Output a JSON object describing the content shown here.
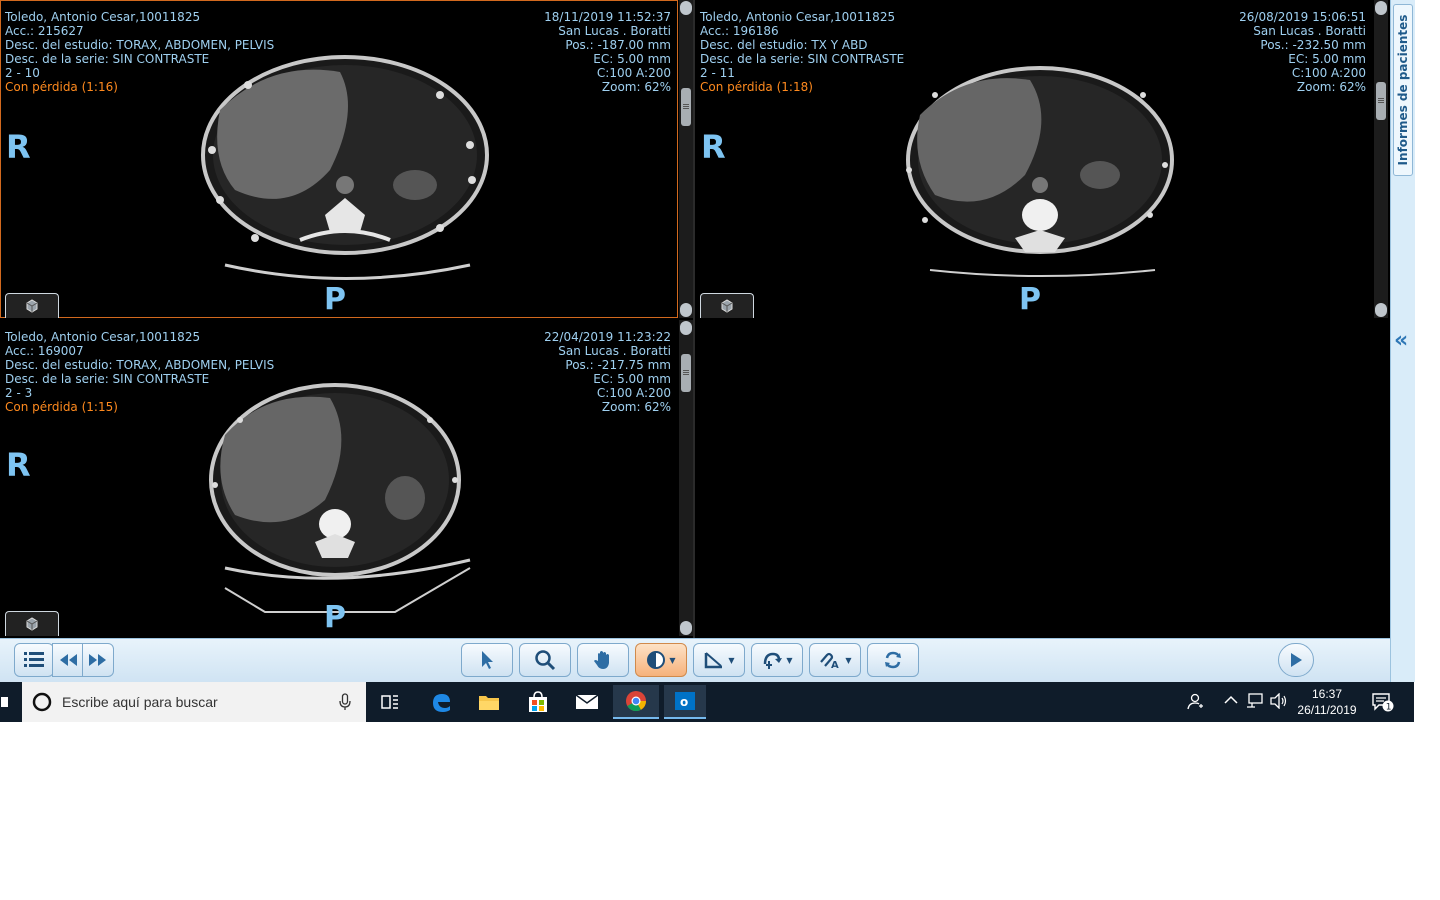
{
  "viewports": [
    {
      "left_lines": [
        "Toledo, Antonio Cesar,10011825",
        "Acc.: 215627",
        "Desc. del estudio: TORAX, ABDOMEN, PELVIS",
        "Desc. de la serie: SIN CONTRASTE",
        "2 - 10"
      ],
      "loss": "Con pérdida (1:16)",
      "right_lines": [
        "18/11/2019 11:52:37",
        "San Lucas . Boratti",
        "Pos.: -187.00 mm",
        "EC: 5.00 mm",
        "C:100 A:200",
        "Zoom: 62%"
      ],
      "orient_side": "R",
      "orient_bottom": "P"
    },
    {
      "left_lines": [
        "Toledo, Antonio Cesar,10011825",
        "Acc.: 196186",
        "Desc. del estudio: TX Y ABD",
        "Desc. de la serie: SIN CONTRASTE",
        "2 - 11"
      ],
      "loss": "Con pérdida (1:18)",
      "right_lines": [
        "26/08/2019 15:06:51",
        "San Lucas . Boratti",
        "Pos.: -232.50 mm",
        "EC: 5.00 mm",
        "C:100 A:200",
        "Zoom: 62%"
      ],
      "orient_side": "R",
      "orient_bottom": "P"
    },
    {
      "left_lines": [
        "Toledo, Antonio Cesar,10011825",
        "Acc.: 169007",
        "Desc. del estudio: TORAX, ABDOMEN, PELVIS",
        "Desc. de la serie: SIN CONTRASTE",
        "2 - 3"
      ],
      "loss": "Con pérdida (1:15)",
      "right_lines": [
        "22/04/2019 11:23:22",
        "San Lucas . Boratti",
        "Pos.: -217.75 mm",
        "EC: 5.00 mm",
        "C:100 A:200",
        "Zoom: 62%"
      ],
      "orient_side": "R",
      "orient_bottom": "P"
    }
  ],
  "side_panel": {
    "label": "Informes de pacientes",
    "collapse": "«"
  },
  "toolbar": {
    "tools": [
      "select-arrow",
      "zoom-magnifier",
      "pan-hand",
      "window-level",
      "measure-line",
      "rotate-flip",
      "annotate-link",
      "reset-refresh"
    ],
    "active_tool": "window-level"
  },
  "taskbar": {
    "search_placeholder": "Escribe aquí para buscar",
    "time": "16:37",
    "date": "26/11/2019",
    "notification_count": "1"
  },
  "colors": {
    "overlay_text": "#9fd0f0",
    "loss_text": "#ff8a1e",
    "orientation": "#7ec4f2",
    "active_border": "#d2691e"
  }
}
